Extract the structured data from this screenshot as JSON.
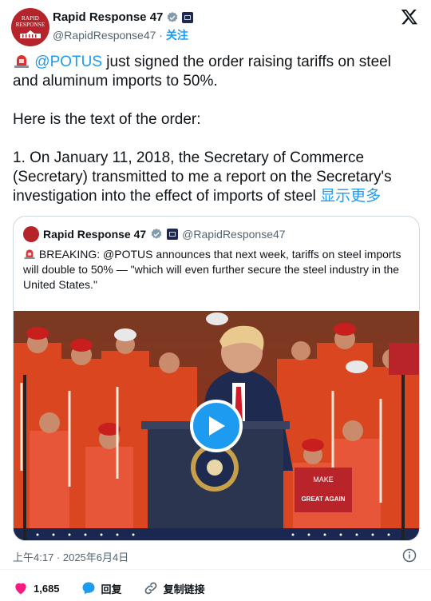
{
  "author": {
    "name": "Rapid Response 47",
    "handle": "@RapidResponse47",
    "separator": "·",
    "follow_label": "关注",
    "avatar_line1": "RAPID",
    "avatar_line2": "RESPONSE"
  },
  "tweet": {
    "mention": "@POTUS",
    "line1_rest": " just signed the order raising tariffs on steel and aluminum imports to 50%.",
    "para2": "Here is the text of the order:",
    "para3": "1. On January 11, 2018, the Secretary of Commerce (Secretary) transmitted to me a report on the Secretary's investigation into the effect of imports of steel ",
    "show_more": "显示更多"
  },
  "quote": {
    "name": "Rapid Response 47",
    "handle": "@RapidResponse47",
    "text": " BREAKING: @POTUS announces that next week, tariffs on steel imports will double to 50% — \"which will even further secure the steel industry in the United States.\""
  },
  "video": {
    "sign_make": "MAKE",
    "sign_great": "GREAT AGAIN"
  },
  "timestamp": "上午4:17 · 2025年6月4日",
  "actions": {
    "likes_count": "1,685",
    "reply_label": "回复",
    "copy_link_label": "复制链接"
  },
  "colors": {
    "accent": "#1d9bf0",
    "like": "#f91880",
    "avatar_red": "#b5242b"
  }
}
